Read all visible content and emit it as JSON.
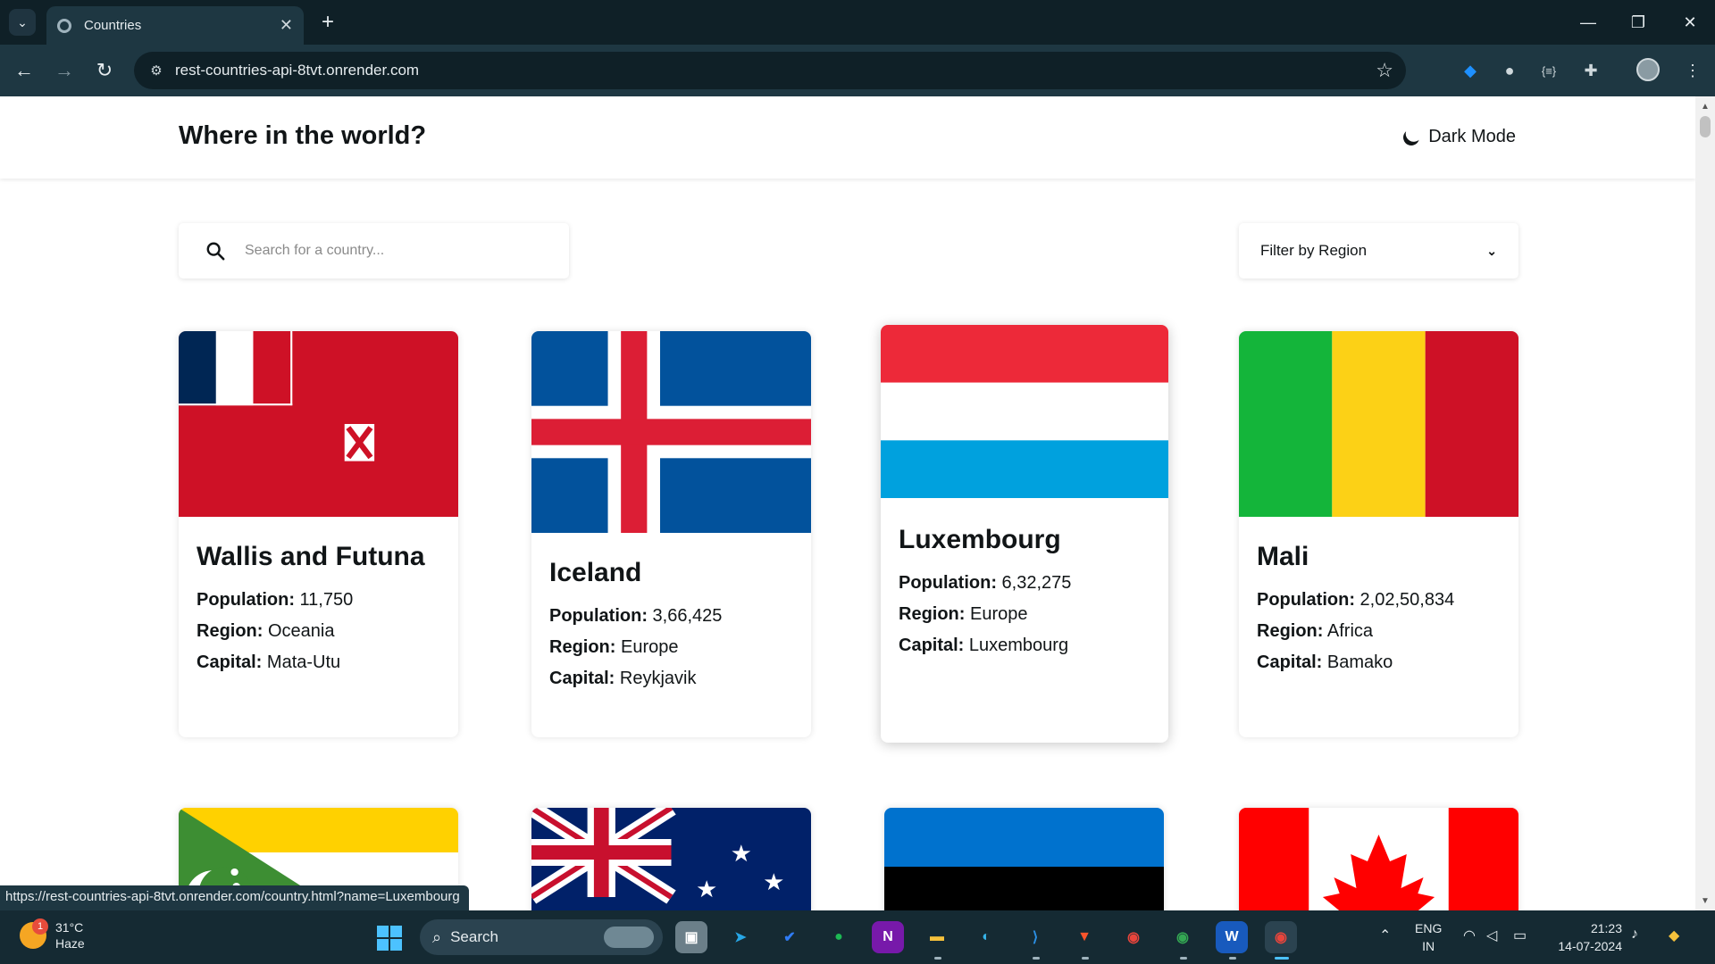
{
  "browser": {
    "tab_title": "Countries",
    "tab_close": "✕",
    "new_tab": "+",
    "address": "rest-countries-api-8tvt.onrender.com",
    "status_url": "https://rest-countries-api-8tvt.onrender.com/country.html?name=Luxembourg"
  },
  "header": {
    "title": "Where in the world?",
    "dark_mode_label": "Dark Mode"
  },
  "search": {
    "placeholder": "Search for a country..."
  },
  "filter": {
    "label": "Filter by Region"
  },
  "labels": {
    "population": "Population:",
    "region": "Region:",
    "capital": "Capital:"
  },
  "countries": [
    {
      "name": "Wallis and Futuna",
      "population": "11,750",
      "region": "Oceania",
      "capital": "Mata-Utu"
    },
    {
      "name": "Iceland",
      "population": "3,66,425",
      "region": "Europe",
      "capital": "Reykjavik"
    },
    {
      "name": "Luxembourg",
      "population": "6,32,275",
      "region": "Europe",
      "capital": "Luxembourg"
    },
    {
      "name": "Mali",
      "population": "2,02,50,834",
      "region": "Africa",
      "capital": "Bamako"
    }
  ],
  "colors": {
    "text": "#111517",
    "chrome_dark": "#0f2027",
    "chrome": "#1e3742"
  },
  "taskbar": {
    "weather_badge": "1",
    "temperature": "31°C",
    "condition": "Haze",
    "search_label": "Search",
    "language": "ENG",
    "region_code": "IN",
    "time": "21:23",
    "date": "14-07-2024"
  }
}
